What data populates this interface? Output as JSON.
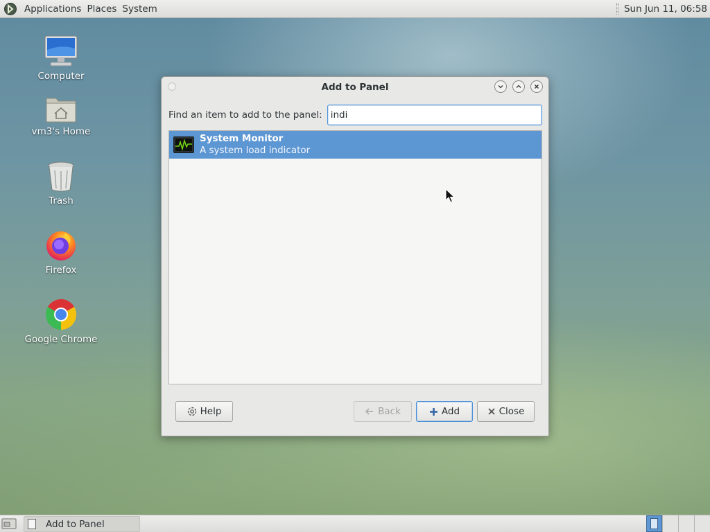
{
  "top_panel": {
    "menus": [
      "Applications",
      "Places",
      "System"
    ],
    "clock": "Sun Jun 11, 06:58"
  },
  "desktop": {
    "icons": [
      {
        "label": "Computer",
        "icon": "computer-icon"
      },
      {
        "label": "vm3's Home",
        "icon": "home-folder-icon"
      },
      {
        "label": "Trash",
        "icon": "trash-icon"
      },
      {
        "label": "Firefox",
        "icon": "firefox-icon"
      },
      {
        "label": "Google Chrome",
        "icon": "chrome-icon"
      }
    ]
  },
  "dialog": {
    "title": "Add to Panel",
    "find_label": "Find an item to add to the panel:",
    "search_value": "indi",
    "results": [
      {
        "name": "System Monitor",
        "description": "A system load indicator",
        "icon": "system-monitor-icon",
        "selected": true
      }
    ],
    "buttons": {
      "help": "Help",
      "back": "Back",
      "add": "Add",
      "close": "Close"
    },
    "accent_color": "#5d97d3"
  },
  "bottom_panel": {
    "task_label": "Add to Panel"
  }
}
